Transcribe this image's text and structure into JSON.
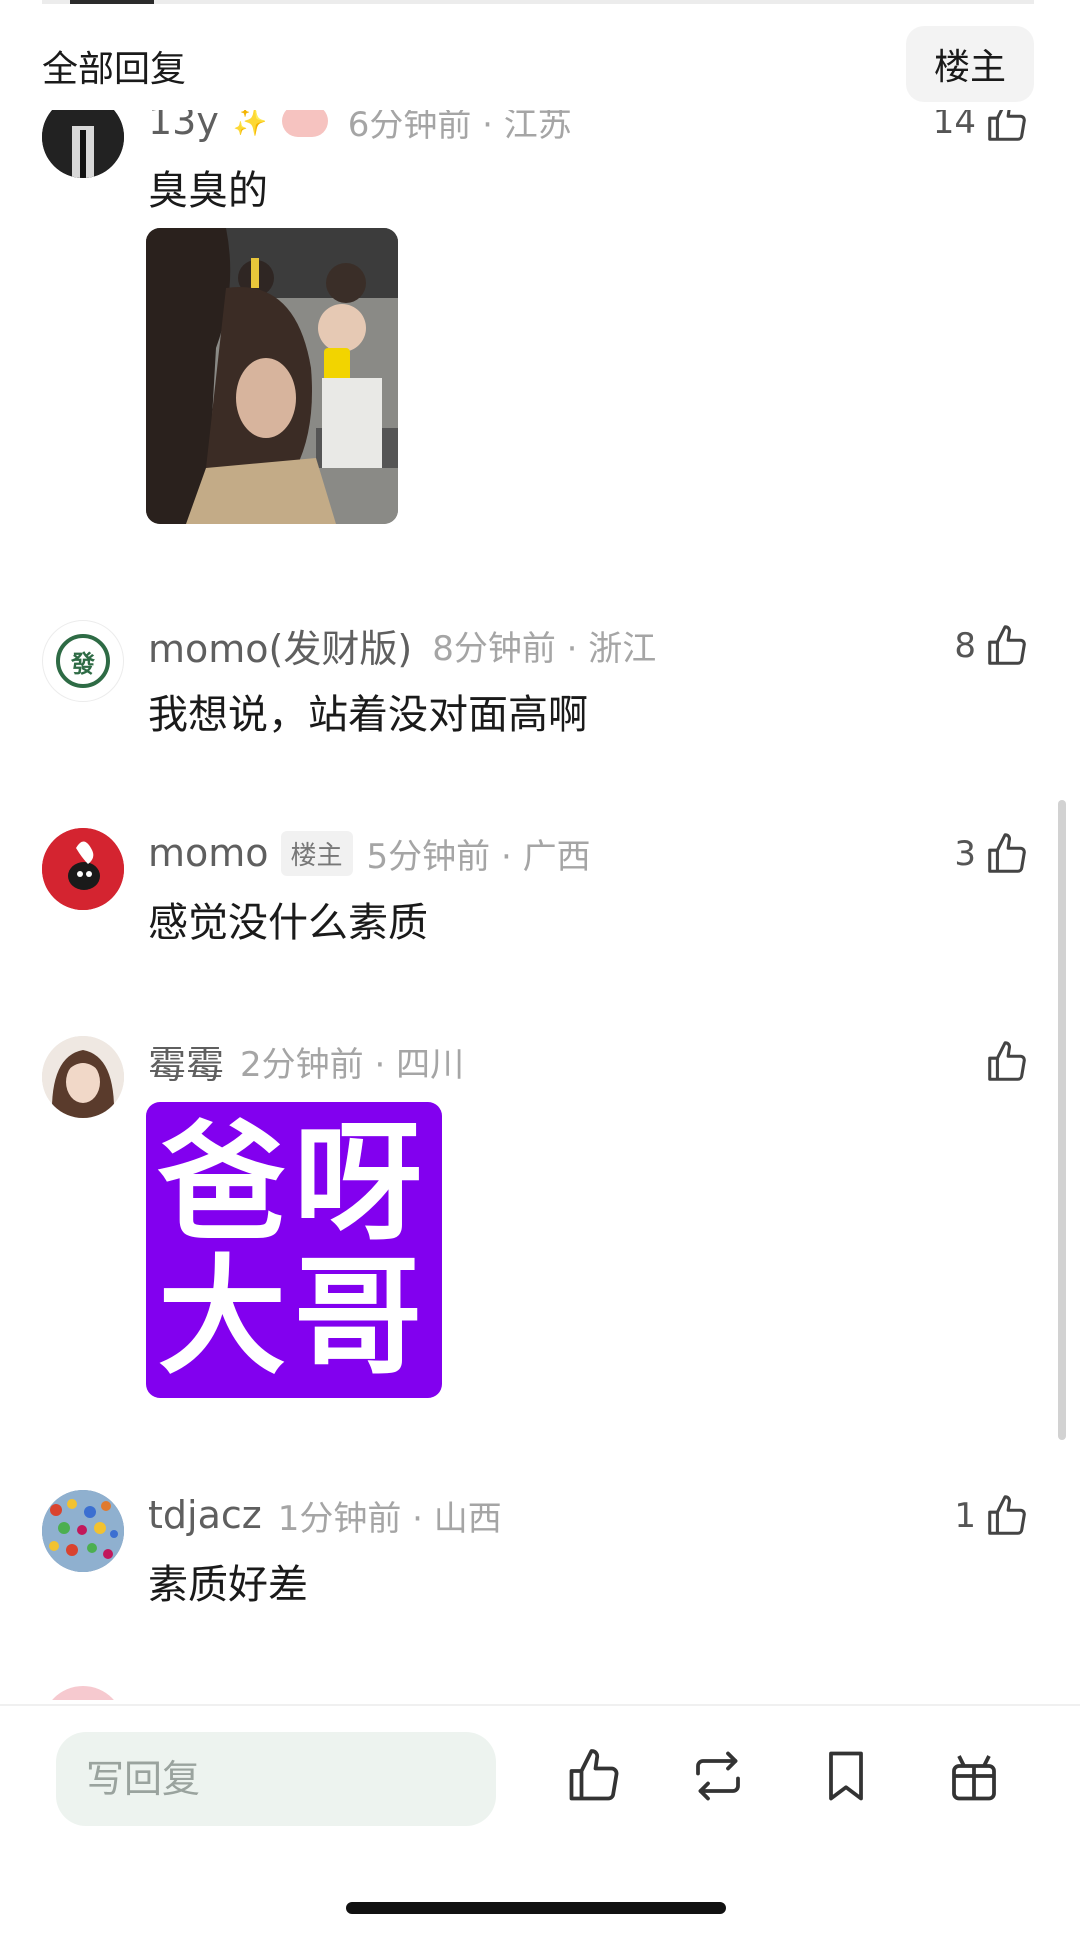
{
  "header": {
    "title": "全部回复",
    "filter_label": "楼主"
  },
  "comments": [
    {
      "username": "13y",
      "time": "6分钟前 · 江苏",
      "likes": "14",
      "text": "臭臭的",
      "has_image": true
    },
    {
      "username": "momo(发财版)",
      "time": "8分钟前 · 浙江",
      "likes": "8",
      "text": "我想说，站着没对面高啊"
    },
    {
      "username": "momo",
      "tag": "楼主",
      "time": "5分钟前 · 广西",
      "likes": "3",
      "text": "感觉没什么素质"
    },
    {
      "username": "霉霉",
      "time": "2分钟前 · 四川",
      "likes": "",
      "sticker": {
        "line1": "爸呀",
        "line2": "大哥"
      }
    },
    {
      "username": "tdjacz",
      "time": "1分钟前 · 山西",
      "likes": "1",
      "text": "素质好差"
    }
  ],
  "avatars": {
    "momo_facai_glyph": "發"
  },
  "bottom_bar": {
    "reply_placeholder": "写回复"
  },
  "colors": {
    "sticker_bg": "#8200ef",
    "input_bg": "#edf3ef",
    "avatar_red": "#d42430"
  }
}
